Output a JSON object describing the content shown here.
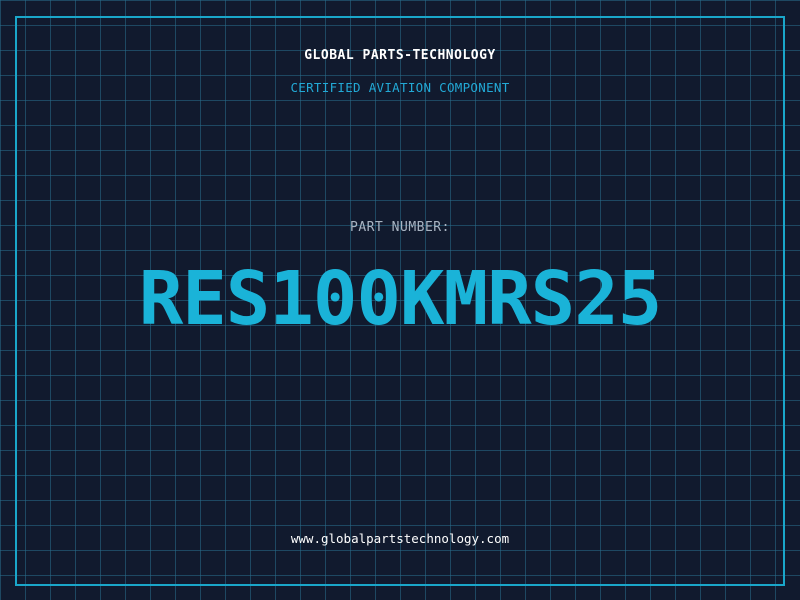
{
  "brand": {
    "name": "GLOBAL PARTS-TECHNOLOGY",
    "tagline": "CERTIFIED AVIATION COMPONENT"
  },
  "part": {
    "label": "PART NUMBER:",
    "number": "RES100KMRS25"
  },
  "footer": {
    "website": "www.globalpartstechnology.com"
  },
  "colors": {
    "background": "#111a2e",
    "grid": "#286e8c",
    "accent": "#1ab3d8",
    "frame": "#1aa6c9",
    "label": "#a9b4c2",
    "text": "#ffffff"
  }
}
